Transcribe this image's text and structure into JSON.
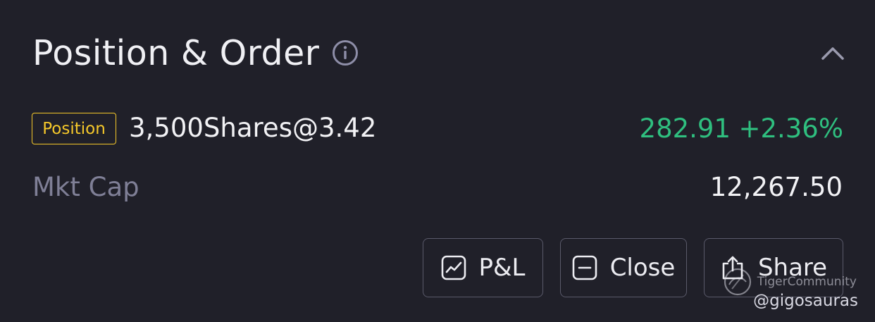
{
  "header": {
    "title": "Position & Order",
    "info_icon": "info-circle-icon",
    "collapse_icon": "chevron-up-icon"
  },
  "position": {
    "badge": "Position",
    "shares": "3,500Shares@3.42",
    "pl_value": "282.91",
    "pl_percent": "+2.36%"
  },
  "market_cap": {
    "label": "Mkt Cap",
    "value": "12,267.50"
  },
  "actions": {
    "pl_label": "P&L",
    "close_label": "Close",
    "share_label": "Share"
  },
  "watermark": {
    "text": "TigerCommunity",
    "handle": "@gigosauras"
  },
  "colors": {
    "background": "#202029",
    "badge": "#f5c82a",
    "positive": "#2fbf7f",
    "muted": "#7f7f96"
  }
}
